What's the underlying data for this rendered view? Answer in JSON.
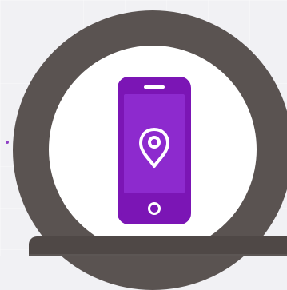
{
  "icon": {
    "name": "phone-location-pin-icon",
    "colors": {
      "accent": "#7b15b5",
      "ring": "#5a5351",
      "background": "#f1f1f4",
      "inner": "#ffffff"
    }
  }
}
